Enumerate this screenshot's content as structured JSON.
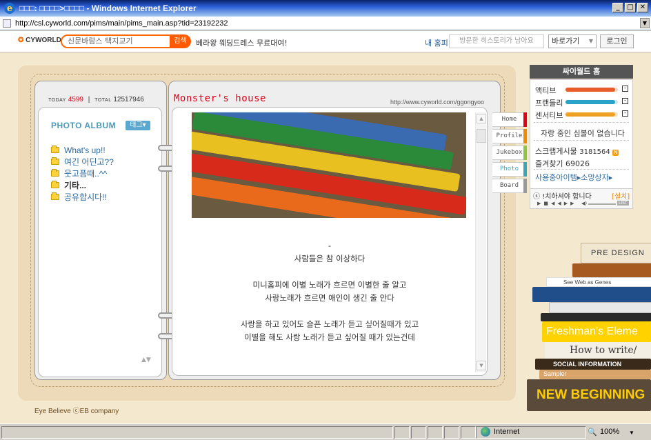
{
  "window": {
    "title": "□□□: □□□□>□□□□ - Windows Internet Explorer",
    "min_glyph": "_",
    "max_glyph": "□",
    "close_glyph": "✕"
  },
  "address": {
    "url": "http://csl.cyworld.com/pims/main/pims_main.asp?tid=23192232"
  },
  "toolbar": {
    "logo": "CYWORLD",
    "search_text": "신문바람스 택지교기",
    "search_button": "검색",
    "promo": "베라왕 웨딩드레스 무료대여!",
    "my_home": "내 홈피",
    "history_placeholder": "방문한 히스토리가 남아요",
    "goto_label": "바로가기",
    "login_label": "로그인"
  },
  "counter": {
    "today_label": "TODAY",
    "today_value": "4599",
    "separator": "|",
    "total_label": "TOTAL",
    "total_value": "12517946"
  },
  "album": {
    "title": "PHOTO ALBUM",
    "tag_button": "태그▾",
    "folders": [
      {
        "label": "What's up!!",
        "bold": false
      },
      {
        "label": "여긴 어딘고??",
        "bold": false
      },
      {
        "label": "웃고픔때..^^",
        "bold": false
      },
      {
        "label": "기타...",
        "bold": true
      },
      {
        "label": "공유합시다!!",
        "bold": false
      }
    ]
  },
  "home": {
    "title": "Monster's house",
    "url": "http://www.cyworld.com/ggongyoo"
  },
  "post": {
    "lines": [
      "-",
      "사람들은 참 이상하다",
      "",
      "미니홈피에 이별 노래가 흐르면 이별한 줄 알고",
      "사랑노래가 흐르면 애인이 생긴 줄 안다",
      "",
      "사랑을 하고 있어도 슬픈 노래가 듣고 싶어질때가 있고",
      "이별을 해도 사랑 노래가 듣고 싶어질 때가 있는건데"
    ]
  },
  "tabs": [
    {
      "label": "Home",
      "color": "#e2001a",
      "active": false
    },
    {
      "label": "Profile",
      "color": "#f08a00",
      "active": false
    },
    {
      "label": "Jukebox",
      "color": "#8cc63f",
      "active": false
    },
    {
      "label": "Photo",
      "color": "#3aa6b9",
      "active": true
    },
    {
      "label": "Board",
      "color": "#999999",
      "active": false
    }
  ],
  "sidebar": {
    "header": "싸이월드 홈",
    "stats": [
      {
        "label": "액티브",
        "color": "#e85c2a",
        "level": 0.95
      },
      {
        "label": "프랜들리",
        "color": "#2aa3c9",
        "level": 0.95
      },
      {
        "label": "센서티브",
        "color": "#f0a020",
        "level": 0.95
      }
    ],
    "status_message": "자랑 중인 심볼이 없습니다",
    "scrap_label": "스크랩게시물",
    "scrap_count": "3181564",
    "scrap_badge": "N",
    "fav_label": "즐겨찾기",
    "fav_count": "69026",
    "items_label": "사용중아이템▸소망상자▸",
    "music_info": "!치하셔야 합니다",
    "music_install": "[설치]",
    "music_controls": "▶■◀◀▶▶",
    "music_vol": "◀)",
    "music_list": "LIST"
  },
  "footer": {
    "text": "Eye Believe ⓒEB company"
  },
  "books": [
    {
      "label": "PRE DESIGN",
      "bg": "#f1e7d0",
      "fg": "#333"
    },
    {
      "label": "",
      "bg": "#a65a1f",
      "fg": "#fff"
    },
    {
      "label": "See Web as Genes",
      "bg": "#ffffff",
      "fg": "#444"
    },
    {
      "label": "",
      "bg": "#1f4e8a",
      "fg": "#fff"
    },
    {
      "label": "",
      "bg": "#e8e8e8",
      "fg": "#333"
    },
    {
      "label": "",
      "bg": "#2a2a2a",
      "fg": "#fff"
    },
    {
      "label": "Freshman's Eleme",
      "bg": "#ffd200",
      "fg": "#fff"
    },
    {
      "label": "How to write/",
      "bg": "#f4efe4",
      "fg": "#333"
    },
    {
      "label": "SOCIAL INFORMATION",
      "bg": "#3a2a1a",
      "fg": "#fff"
    },
    {
      "label": "Sampler",
      "bg": "#d9a46a",
      "fg": "#fff"
    },
    {
      "label": "NEW BEGINNING",
      "bg": "#5a4a3a",
      "fg": "#ffcc00"
    }
  ],
  "statusbar": {
    "zone": "Internet",
    "zoom": "100%"
  }
}
